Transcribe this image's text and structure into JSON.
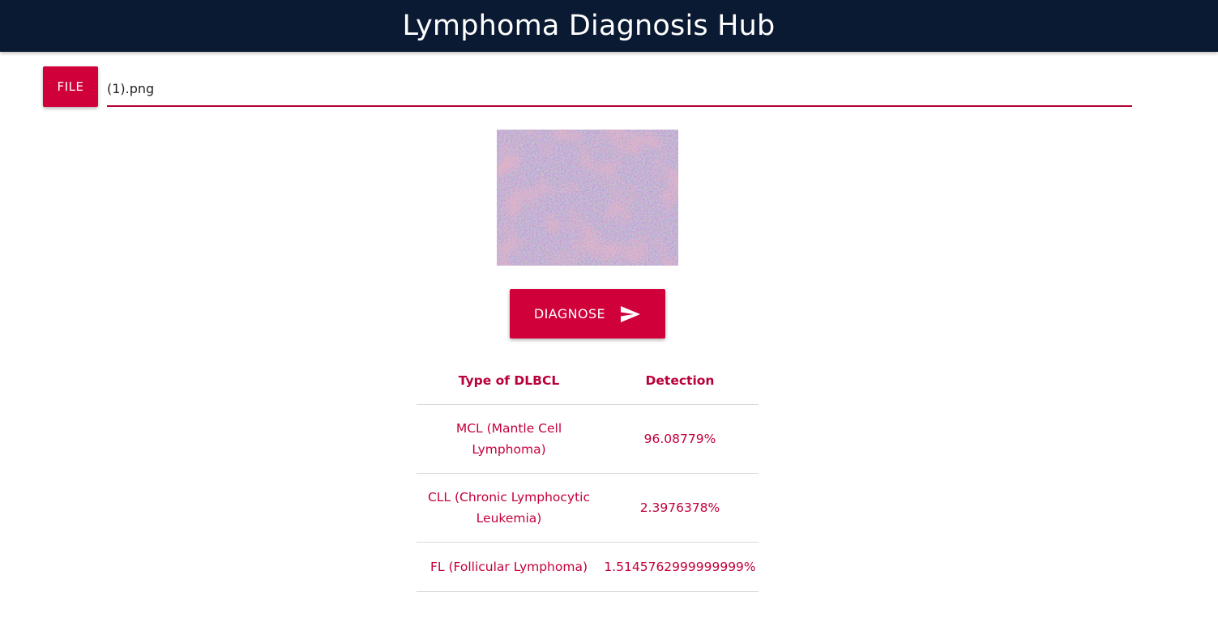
{
  "header": {
    "title": "Lymphoma Diagnosis Hub"
  },
  "upload": {
    "file_button_label": "FILE",
    "file_name": "(1).png"
  },
  "diagnose": {
    "label": "DIAGNOSE",
    "icon": "send-icon"
  },
  "results": {
    "headers": [
      "Type of DLBCL",
      "Detection"
    ],
    "rows": [
      {
        "type": "MCL (Mantle Cell Lymphoma)",
        "detection": "96.08779%"
      },
      {
        "type": "CLL (Chronic Lymphocytic Leukemia)",
        "detection": "2.3976378%"
      },
      {
        "type": "FL (Follicular Lymphoma)",
        "detection": "1.5145762999999999%"
      }
    ]
  },
  "colors": {
    "header_bg": "#0b1a33",
    "accent": "#d0003a",
    "text_accent": "#c4003a"
  }
}
